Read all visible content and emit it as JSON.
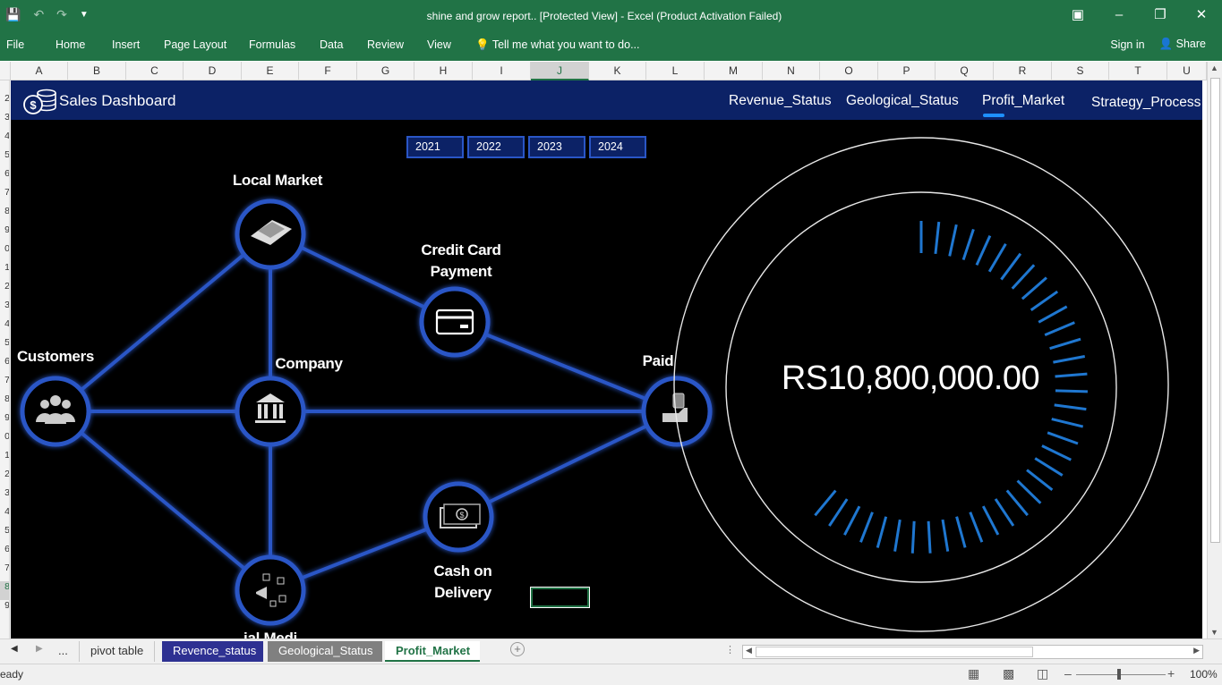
{
  "window": {
    "title": "shine and grow report..  [Protected View] - Excel (Product Activation Failed)"
  },
  "ribbon": {
    "tabs": [
      "File",
      "Home",
      "Insert",
      "Page Layout",
      "Formulas",
      "Data",
      "Review",
      "View"
    ],
    "tell_me": "Tell me what you want to do...",
    "sign_in": "Sign in",
    "share": "Share"
  },
  "grid": {
    "columns": [
      "A",
      "B",
      "C",
      "D",
      "E",
      "F",
      "G",
      "H",
      "I",
      "J",
      "K",
      "L",
      "M",
      "N",
      "O",
      "P",
      "Q",
      "R",
      "S",
      "T",
      "U"
    ],
    "selected_column": "J",
    "rows": [
      "2",
      "3",
      "4",
      "5",
      "6",
      "7",
      "8",
      "9",
      "0",
      "1",
      "2",
      "3",
      "4",
      "5",
      "6",
      "7",
      "8",
      "9",
      "0",
      "1",
      "2",
      "3",
      "4",
      "5",
      "6",
      "7",
      "8",
      "9"
    ],
    "selected_row": "8"
  },
  "dashboard": {
    "title": "Sales Dashboard",
    "nav": [
      "Revenue_Status",
      "Geological_Status",
      "Profit_Market",
      "Strategy_Process"
    ],
    "active_nav": "Profit_Market",
    "years": [
      "2021",
      "2022",
      "2023",
      "2024"
    ],
    "nodes": {
      "local_market": "Local Market",
      "credit_card": "Credit Card\nPayment",
      "customers": "Customers",
      "company": "Company",
      "paid": "Paid",
      "cash_on_delivery": "Cash on\nDelivery",
      "social_media_partial": "ial Medi"
    },
    "gauge": {
      "value_text": "RS10,800,000.00",
      "tick_color": "#1f77d0"
    }
  },
  "sheets": {
    "more": "...",
    "tabs": [
      "pivot table",
      "Revence_status",
      "Geological_Status",
      "Profit_Market"
    ],
    "active": "Profit_Market"
  },
  "status": {
    "ready": "eady",
    "zoom": "100%"
  }
}
